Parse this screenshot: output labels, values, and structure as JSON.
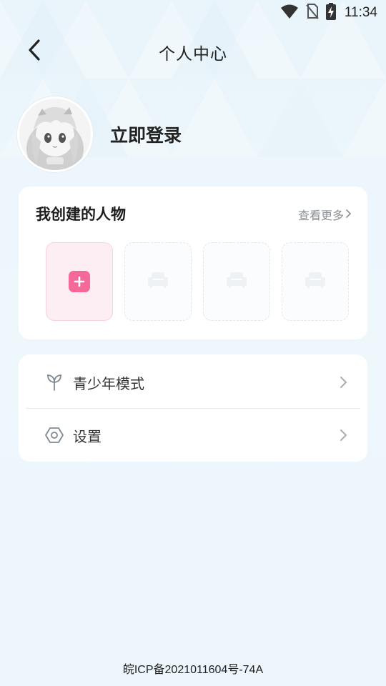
{
  "status_bar": {
    "time": "11:34",
    "icons": [
      "wifi-icon",
      "no-sim-icon",
      "battery-charging-icon"
    ]
  },
  "header": {
    "title": "个人中心",
    "back_icon": "chevron-left-icon"
  },
  "profile": {
    "avatar_icon": "anime-avatar",
    "login_label": "立即登录"
  },
  "characters": {
    "title": "我创建的人物",
    "see_more": "查看更多",
    "add_icon": "plus-icon",
    "empty_slot_icon": "sofa-icon",
    "empty_slots": 3
  },
  "menu": {
    "items": [
      {
        "label": "青少年模式",
        "icon": "sprout-icon"
      },
      {
        "label": "设置",
        "icon": "hexagon-gear-icon"
      }
    ]
  },
  "footer": {
    "icp": "皖ICP备2021011604号-74A"
  },
  "colors": {
    "accent_pink": "#f5689a",
    "background": "#eaf5fb",
    "card": "#ffffff"
  }
}
